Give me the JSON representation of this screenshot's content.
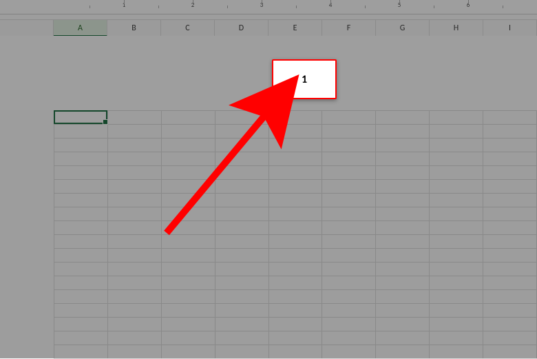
{
  "ruler": {
    "marks": [
      "1",
      "2",
      "3",
      "4",
      "5",
      "6"
    ]
  },
  "columns": [
    "A",
    "B",
    "C",
    "D",
    "E",
    "F",
    "G",
    "H",
    "I"
  ],
  "selected_column": "A",
  "selected_cell": "A1",
  "callout": {
    "text": "1"
  },
  "grid": {
    "rows": 18,
    "cols": 9
  }
}
